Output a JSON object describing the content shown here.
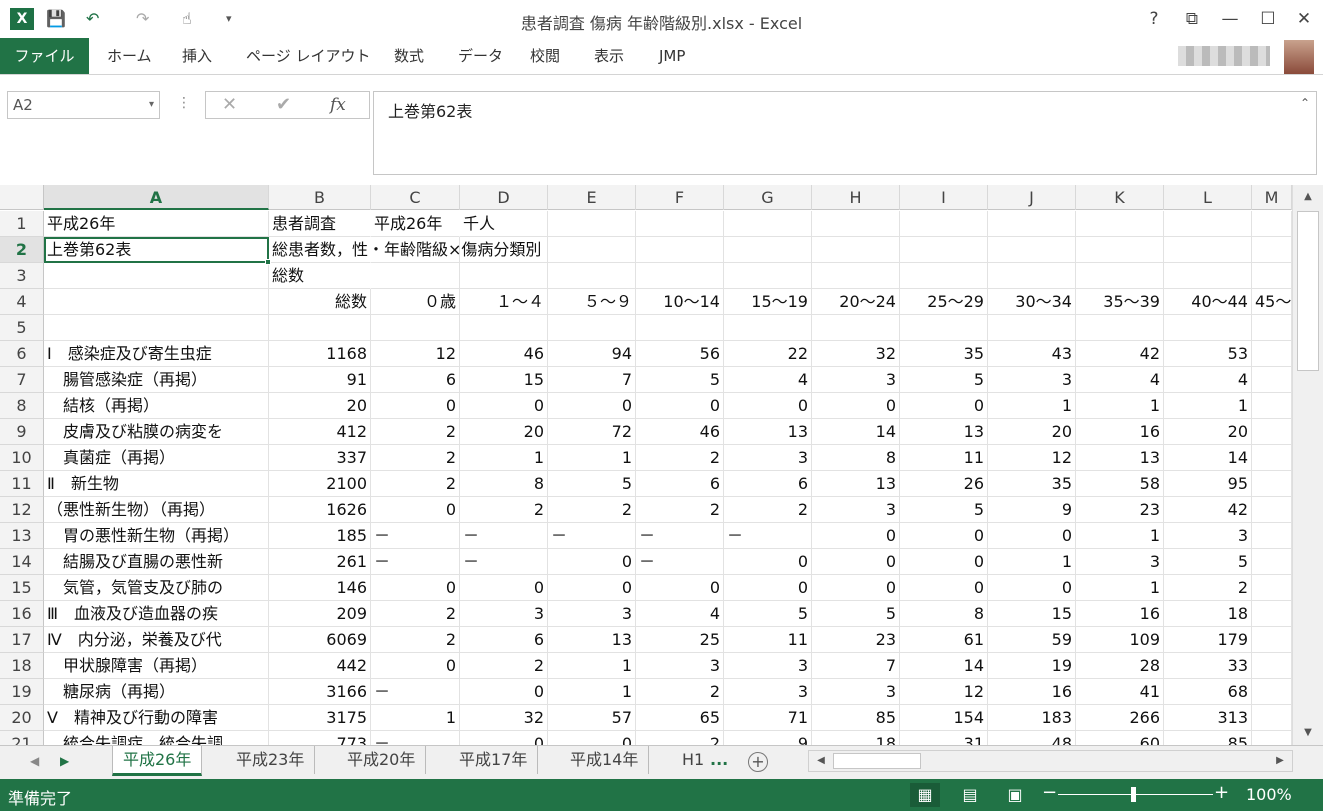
{
  "window": {
    "app_logo": "X",
    "title": "患者調査  傷病 年齢階級別.xlsx - Excel",
    "help": "?",
    "controls": [
      "⧉",
      "—",
      "☐",
      "✕"
    ]
  },
  "ribbon": {
    "file_tab": "ファイル",
    "tabs": [
      "ホーム",
      "挿入",
      "ページ レイアウト",
      "数式",
      "データ",
      "校閲",
      "表示",
      "JMP"
    ]
  },
  "formula_bar": {
    "name_box": "A2",
    "cancel": "✕",
    "enter": "✔",
    "fx": "fx",
    "content": "上巻第62表"
  },
  "columns": [
    "A",
    "B",
    "C",
    "D",
    "E",
    "F",
    "G",
    "H",
    "I",
    "J",
    "K",
    "L",
    "M"
  ],
  "rows": [
    {
      "n": "1",
      "cells": [
        "平成26年",
        "患者調査",
        "平成26年",
        "千人",
        "",
        "",
        "",
        "",
        "",
        "",
        "",
        "",
        ""
      ]
    },
    {
      "n": "2",
      "cells": [
        "上巻第62表",
        "総患者数，性・年齢階級×傷病分類別",
        "",
        "",
        "",
        "",
        "",
        "",
        "",
        "",
        "",
        "",
        ""
      ]
    },
    {
      "n": "3",
      "cells": [
        "",
        "総数",
        "",
        "",
        "",
        "",
        "",
        "",
        "",
        "",
        "",
        "",
        ""
      ]
    },
    {
      "n": "4",
      "cells": [
        "",
        "総数",
        "０歳",
        "１～４",
        "５～９",
        "10～14",
        "15～19",
        "20～24",
        "25～29",
        "30～34",
        "35～39",
        "40～44",
        "45～"
      ]
    },
    {
      "n": "5",
      "cells": [
        "",
        "",
        "",
        "",
        "",
        "",
        "",
        "",
        "",
        "",
        "",
        "",
        ""
      ]
    },
    {
      "n": "6",
      "cells": [
        "Ⅰ　感染症及び寄生虫症",
        "1168",
        "12",
        "46",
        "94",
        "56",
        "22",
        "32",
        "35",
        "43",
        "42",
        "53",
        ""
      ]
    },
    {
      "n": "7",
      "cells": [
        "　腸管感染症（再掲）",
        "91",
        "6",
        "15",
        "7",
        "5",
        "4",
        "3",
        "5",
        "3",
        "4",
        "4",
        ""
      ]
    },
    {
      "n": "8",
      "cells": [
        "　結核（再掲）",
        "20",
        "0",
        "0",
        "0",
        "0",
        "0",
        "0",
        "0",
        "1",
        "1",
        "1",
        ""
      ]
    },
    {
      "n": "9",
      "cells": [
        "　皮膚及び粘膜の病変を",
        "412",
        "2",
        "20",
        "72",
        "46",
        "13",
        "14",
        "13",
        "20",
        "16",
        "20",
        ""
      ]
    },
    {
      "n": "10",
      "cells": [
        "　真菌症（再掲）",
        "337",
        "2",
        "1",
        "1",
        "2",
        "3",
        "8",
        "11",
        "12",
        "13",
        "14",
        ""
      ]
    },
    {
      "n": "11",
      "cells": [
        "Ⅱ　新生物",
        "2100",
        "2",
        "8",
        "5",
        "6",
        "6",
        "13",
        "26",
        "35",
        "58",
        "95",
        ""
      ]
    },
    {
      "n": "12",
      "cells": [
        "（悪性新生物）（再掲）",
        "1626",
        "0",
        "2",
        "2",
        "2",
        "2",
        "3",
        "5",
        "9",
        "23",
        "42",
        ""
      ]
    },
    {
      "n": "13",
      "cells": [
        "　胃の悪性新生物（再掲）",
        "185",
        "－",
        "－",
        "－",
        "－",
        "－",
        "0",
        "0",
        "0",
        "1",
        "3",
        ""
      ]
    },
    {
      "n": "14",
      "cells": [
        "　結腸及び直腸の悪性新",
        "261",
        "－",
        "－",
        "0",
        "－",
        "0",
        "0",
        "0",
        "1",
        "3",
        "5",
        ""
      ]
    },
    {
      "n": "15",
      "cells": [
        "　気管，気管支及び肺の",
        "146",
        "0",
        "0",
        "0",
        "0",
        "0",
        "0",
        "0",
        "0",
        "1",
        "2",
        ""
      ]
    },
    {
      "n": "16",
      "cells": [
        "Ⅲ　血液及び造血器の疾",
        "209",
        "2",
        "3",
        "3",
        "4",
        "5",
        "5",
        "8",
        "15",
        "16",
        "18",
        ""
      ]
    },
    {
      "n": "17",
      "cells": [
        "Ⅳ　内分泌，栄養及び代",
        "6069",
        "2",
        "6",
        "13",
        "25",
        "11",
        "23",
        "61",
        "59",
        "109",
        "179",
        ""
      ]
    },
    {
      "n": "18",
      "cells": [
        "　甲状腺障害（再掲）",
        "442",
        "0",
        "2",
        "1",
        "3",
        "3",
        "7",
        "14",
        "19",
        "28",
        "33",
        ""
      ]
    },
    {
      "n": "19",
      "cells": [
        "　糖尿病（再掲）",
        "3166",
        "－",
        "0",
        "1",
        "2",
        "3",
        "3",
        "12",
        "16",
        "41",
        "68",
        ""
      ]
    },
    {
      "n": "20",
      "cells": [
        "Ⅴ　精神及び行動の障害",
        "3175",
        "1",
        "32",
        "57",
        "65",
        "71",
        "85",
        "154",
        "183",
        "266",
        "313",
        ""
      ]
    },
    {
      "n": "21",
      "cells": [
        "　統合失調症，統合失調",
        "773",
        "－",
        "0",
        "0",
        "2",
        "9",
        "18",
        "31",
        "48",
        "60",
        "85",
        ""
      ]
    }
  ],
  "sheets": {
    "active": "平成26年",
    "others": [
      "平成23年",
      "平成20年",
      "平成17年",
      "平成14年",
      "H1"
    ],
    "more": "...",
    "add": "+"
  },
  "status": {
    "ready": "準備完了",
    "zoom": "100%",
    "zoom_minus": "−",
    "zoom_plus": "+"
  }
}
